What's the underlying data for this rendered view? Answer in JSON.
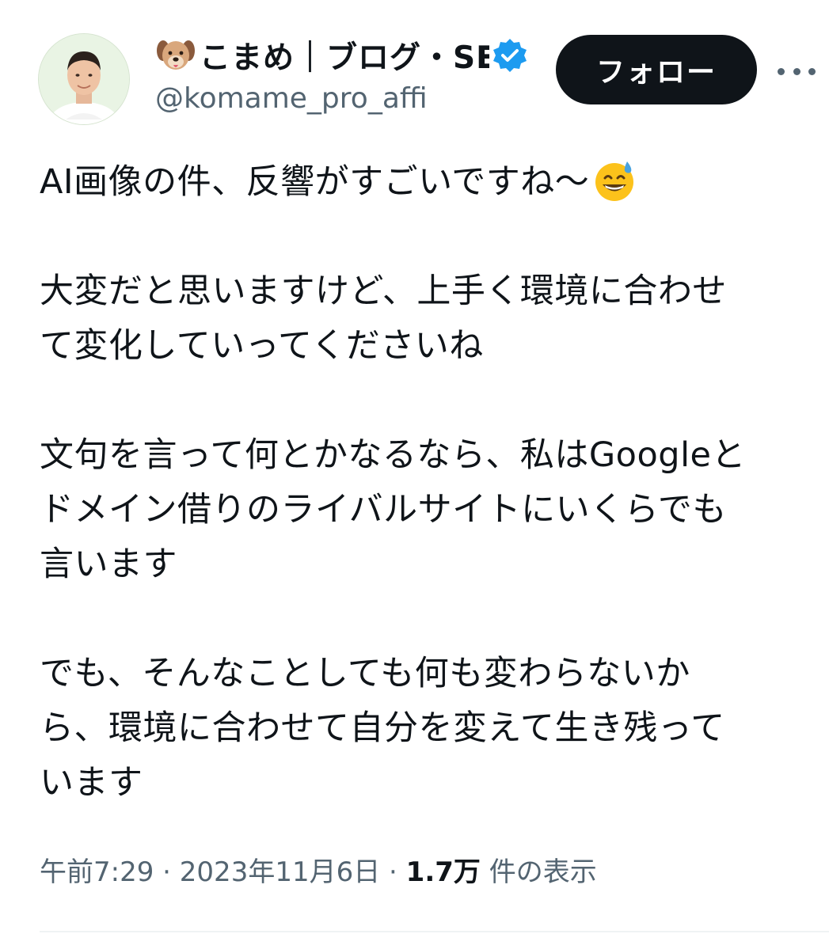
{
  "user": {
    "display_name": "こまめ｜ブログ・SE",
    "handle": "@komame_pro_affi"
  },
  "actions": {
    "follow_label": "フォロー"
  },
  "tweet": {
    "line1": "AI画像の件、反響がすごいですね〜",
    "line2": "大変だと思いますけど、上手く環境に合わせ",
    "line3": "て変化していってくださいね",
    "line4": "文句を言って何とかなるなら、私はGoogleと",
    "line5": "ドメイン借りのライバルサイトにいくらでも",
    "line6": "言います",
    "line7": "でも、そんなことしても何も変わらないか",
    "line8": "ら、環境に合わせて自分を変えて生き残って",
    "line9": "います"
  },
  "meta": {
    "time": "午前7:29",
    "separator": "·",
    "date": "2023年11月6日",
    "views_count": "1.7万",
    "views_label": "件の表示"
  },
  "icons": {
    "dog": "dog-face-icon",
    "verified": "verified-badge-icon",
    "emoji": "grinning-face-with-sweat-icon",
    "more": "more-dots-icon"
  },
  "colors": {
    "verified_blue": "#1d9bf0",
    "follow_bg": "#0f1419",
    "secondary_text": "#536471"
  }
}
